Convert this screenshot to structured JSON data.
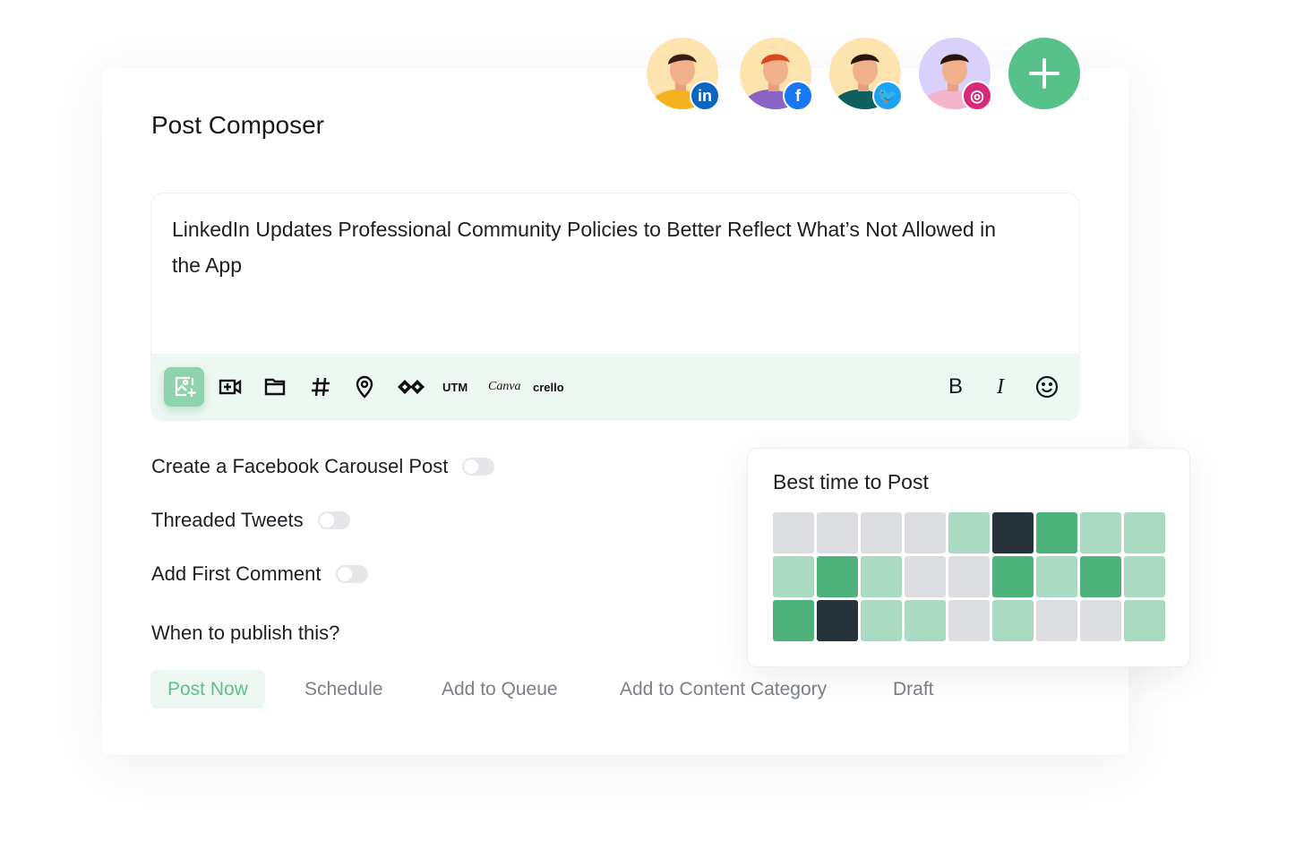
{
  "composer": {
    "title": "Post Composer",
    "post_text": "LinkedIn Updates Professional Community Policies to Better Reflect What’s Not Allowed in the App"
  },
  "accounts": [
    {
      "network": "linkedin",
      "badge_color": "#0a66c2",
      "bg": "#fde3ae",
      "shirt": "#f5b21f",
      "hair": "#3a1e16"
    },
    {
      "network": "facebook",
      "badge_color": "#1877f2",
      "bg": "#fde3ae",
      "shirt": "#8a64c4",
      "hair": "#d9481f"
    },
    {
      "network": "twitter",
      "badge_color": "#1da1f2",
      "bg": "#fde3ae",
      "shirt": "#0e5f5f",
      "hair": "#2a1410"
    },
    {
      "network": "instagram",
      "badge_color": "#d6297a",
      "bg": "#d9d0fb",
      "shirt": "#f3b4cc",
      "hair": "#2a1410"
    }
  ],
  "toolbar": {
    "icons": [
      "add-image-icon",
      "add-video-icon",
      "folder-icon",
      "hashtag-icon",
      "location-icon",
      "integration-icon"
    ],
    "utm_label": "UTM",
    "canva_label": "Canva",
    "crello_label": "crello",
    "bold_label": "B",
    "italic_label": "I"
  },
  "options": [
    {
      "label": "Create a Facebook Carousel Post",
      "enabled": false
    },
    {
      "label": "Threaded Tweets",
      "enabled": false
    },
    {
      "label": "Add First Comment",
      "enabled": false
    }
  ],
  "publish": {
    "question": "When to publish this?",
    "buttons": [
      "Post Now",
      "Schedule",
      "Add to Queue",
      "Add to Content Category",
      "Draft"
    ],
    "selected": "Post Now"
  },
  "best_time": {
    "title": "Best time to Post",
    "levels_legend": {
      "0": "#dcdde0",
      "1": "#aadbc2",
      "2": "#4eb27b",
      "3": "#27333a"
    },
    "grid": [
      [
        0,
        0,
        0,
        0,
        1,
        3,
        2,
        1,
        1
      ],
      [
        1,
        2,
        1,
        0,
        0,
        2,
        1,
        2,
        1
      ],
      [
        2,
        3,
        1,
        1,
        0,
        1,
        0,
        0,
        1
      ]
    ]
  },
  "colors": {
    "accent": "#56c188",
    "toolbar_bg": "#eef8f2"
  }
}
